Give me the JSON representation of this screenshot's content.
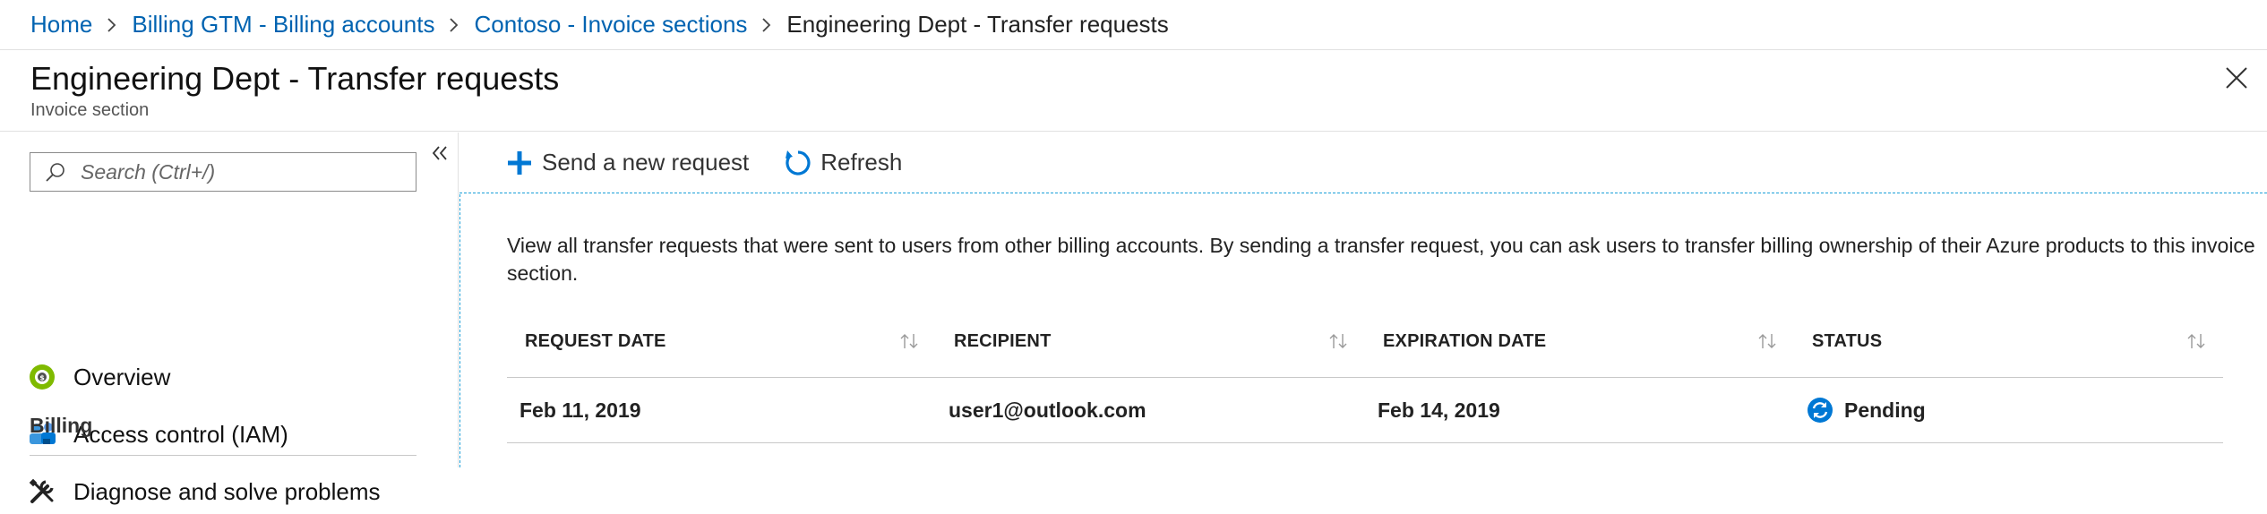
{
  "breadcrumb": {
    "items": [
      {
        "label": "Home"
      },
      {
        "label": "Billing GTM - Billing accounts"
      },
      {
        "label": "Contoso - Invoice sections"
      }
    ],
    "current": "Engineering Dept - Transfer requests"
  },
  "blade": {
    "title": "Engineering Dept - Transfer requests",
    "subtitle": "Invoice section"
  },
  "sidebar": {
    "search_placeholder": "Search (Ctrl+/)",
    "items": [
      {
        "label": "Overview",
        "icon": "overview-icon"
      },
      {
        "label": "Access control (IAM)",
        "icon": "iam-icon"
      },
      {
        "label": "Diagnose and solve problems",
        "icon": "wrench-icon"
      }
    ],
    "section_heading": "Billing"
  },
  "toolbar": {
    "new_request_label": "Send a new request",
    "refresh_label": "Refresh"
  },
  "main": {
    "description": "View all transfer requests that were sent to users from other billing accounts. By sending a transfer request, you can ask users to transfer billing ownership of their Azure products to this invoice section.",
    "columns": [
      "REQUEST DATE",
      "RECIPIENT",
      "EXPIRATION DATE",
      "STATUS"
    ],
    "rows": [
      {
        "request_date": "Feb 11, 2019",
        "recipient": "user1@outlook.com",
        "expiration_date": "Feb 14, 2019",
        "status": "Pending"
      }
    ]
  },
  "colors": {
    "link": "#0063b1",
    "accent": "#0078d4",
    "overview_icon": "#7fba00",
    "dashed_border": "#1a9fd8"
  }
}
